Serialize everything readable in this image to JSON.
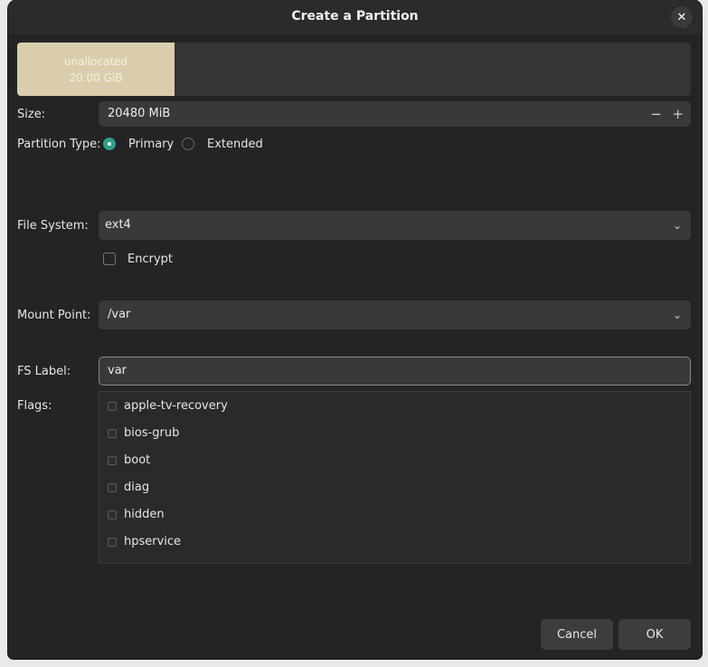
{
  "window": {
    "title": "Create a Partition",
    "close_icon": "close-icon"
  },
  "disk_bar": {
    "segment_label": "unallocated",
    "segment_size": "20.00 GiB"
  },
  "size": {
    "label": "Size:",
    "value": "20480 MiB",
    "decrement": "−",
    "increment": "+"
  },
  "partition_type": {
    "label": "Partition Type:",
    "options": [
      {
        "label": "Primary",
        "selected": true
      },
      {
        "label": "Extended",
        "selected": false
      }
    ]
  },
  "file_system": {
    "label": "File System:",
    "value": "ext4"
  },
  "encrypt": {
    "label": "Encrypt",
    "checked": false
  },
  "mount_point": {
    "label": "Mount Point:",
    "value": "/var"
  },
  "fs_label": {
    "label": "FS Label:",
    "value": "var"
  },
  "flags": {
    "label": "Flags:",
    "items": [
      "apple-tv-recovery",
      "bios-grub",
      "boot",
      "diag",
      "hidden",
      "hpservice"
    ]
  },
  "buttons": {
    "cancel": "Cancel",
    "ok": "OK"
  },
  "colors": {
    "accent": "#2e9f86",
    "segment": "#dacdad",
    "background": "#242424"
  }
}
